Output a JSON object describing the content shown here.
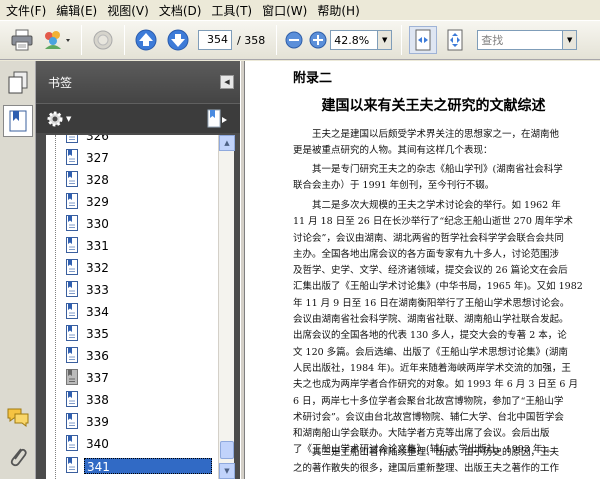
{
  "menubar": {
    "items": [
      "文件(F)",
      "编辑(E)",
      "视图(V)",
      "文档(D)",
      "工具(T)",
      "窗口(W)",
      "帮助(H)"
    ]
  },
  "toolbar": {
    "current_page": "354",
    "total_pages": "/ 358",
    "zoom": "42.8%",
    "find_placeholder": "查找"
  },
  "bookmarks": {
    "title": "书签",
    "items": [
      {
        "label": "326"
      },
      {
        "label": "327"
      },
      {
        "label": "328"
      },
      {
        "label": "329"
      },
      {
        "label": "330"
      },
      {
        "label": "331"
      },
      {
        "label": "332"
      },
      {
        "label": "333"
      },
      {
        "label": "334"
      },
      {
        "label": "335"
      },
      {
        "label": "336"
      },
      {
        "label": "337"
      },
      {
        "label": "338"
      },
      {
        "label": "339"
      },
      {
        "label": "340"
      },
      {
        "label": "341"
      }
    ],
    "selected_label": "341"
  },
  "document": {
    "heading": "附录二",
    "title": "建国以来有关王夫之研究的文献综述",
    "para1": [
      "　　王夫之是建国以后颇受学术界关注的思想家之一，在湖南他",
      "更是被重点研究的人物。其间有这样几个表现："
    ],
    "para2": [
      "　　其一是专门研究王夫之的杂志《船山学刊》(湖南省社会科学",
      "联合会主办）于 1991 年创刊，至今刊行不辍。"
    ],
    "para3": [
      "　　其二是多次大规模的王夫之学术讨论会的举行。如 1962 年",
      "11 月 18 日至 26 日在长沙举行了“纪念王船山逝世 270 周年学术",
      "讨论会”，会议由湖南、湖北两省的哲学社会科学学会联合会共同",
      "主办。全国各地出席会议的各方面专家有九十多人，讨论范围涉",
      "及哲学、史学、文学、经济诸领域，提交会议的 26 篇论文在会后",
      "汇集出版了《王船山学术讨论集》(中华书局，1965 年)。又如 1982",
      "年 11 月 9 日至 16 日在湖南衡阳举行了王船山学术思想讨论会。",
      "会议由湖南省社会科学院、湖南省社联、湖南船山学社联合发起。",
      "出席会议的全国各地的代表 130 多人，提交大会的专著 2 本，论",
      "文 120 多篇。会后选编、出版了《王船山学术思想讨论集》(湖南",
      "人民出版社，1984 年)。近年来随着海峡两岸学术交流的加强，王",
      "夫之也成为两岸学者合作研究的对象。如 1993 年 6 月 3 日至 6 月",
      "6 日，两岸七十多位学者会聚台北故宫博物院，参加了“王船山学",
      "术研讨会”。会议由台北故宫博物院、辅仁大学、台北中国哲学会",
      "和湖南船山学会联办。大陆学者方克等出席了会议。会后出版",
      "了《王船山学术研讨会论文集》(辅仁大学出版社，1993 年)。"
    ],
    "para4": [
      "　　其三是王船山著作陆续整理、出版。由于历史的原因，王夫",
      "之的著作散失的很多，建国后重新整理、出版王夫之著作的工作"
    ]
  },
  "colors": {
    "accent": "#316ac5",
    "pane_bg": "#4b4b4b"
  }
}
